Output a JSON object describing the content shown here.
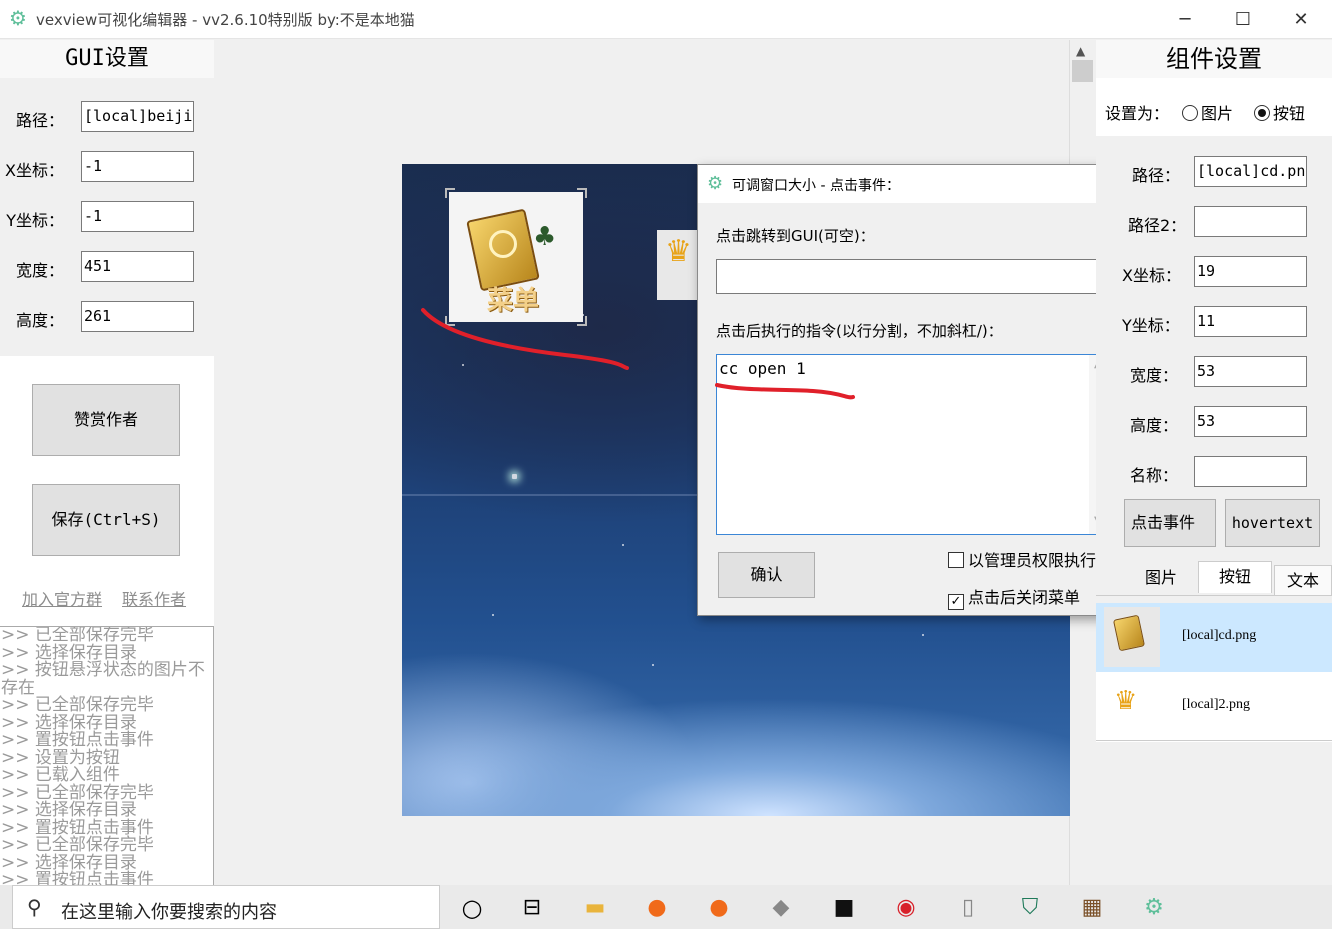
{
  "window": {
    "title": "vexview可视化编辑器 - vv2.6.10特别版  by:不是本地猫",
    "minimize": "─",
    "maximize": "☐",
    "close": "✕",
    "icon": "gear-icon"
  },
  "gui_settings": {
    "title": "GUI设置",
    "path_label": "路径：",
    "path_value": "[local]beijing.png",
    "x_label": "X坐标：",
    "x_value": "-1",
    "y_label": "Y坐标：",
    "y_value": "-1",
    "width_label": "宽度：",
    "width_value": "451",
    "height_label": "高度：",
    "height_value": "261",
    "donate_button": "赞赏作者",
    "save_button": "保存(Ctrl+S)",
    "join_group_link": "加入官方群",
    "contact_link": "联系作者"
  },
  "log": [
    ">> 已全部保存完毕",
    ">> 选择保存目录",
    ">> 按钮悬浮状态的图片不",
    "存在",
    ">> 已全部保存完毕",
    ">> 选择保存目录",
    ">> 置按钮点击事件",
    ">> 设置为按钮",
    ">> 已载入组件",
    ">> 已全部保存完毕",
    ">> 选择保存目录",
    ">> 置按钮点击事件",
    ">> 已全部保存完毕",
    ">> 选择保存目录",
    ">> 置按钮点击事件"
  ],
  "canvas": {
    "menu_icon_text": "菜单"
  },
  "dialog": {
    "title": "可调窗口大小 - 点击事件：",
    "close": "✕",
    "goto_label": "点击跳转到GUI(可空)：",
    "goto_value": "",
    "command_label": "点击后执行的指令(以行分割，不加斜杠/)：",
    "command_value": "cc open 1",
    "confirm_button": "确认",
    "admin_checkbox": "以管理员权限执行",
    "admin_checked": false,
    "close_menu_checkbox": "点击后关闭菜单",
    "close_menu_checked": true
  },
  "component_settings": {
    "title": "组件设置",
    "set_as_label": "设置为：",
    "option_image": "图片",
    "option_button": "按钮",
    "selected": "按钮",
    "path_label": "路径：",
    "path_value": "[local]cd.png",
    "path2_label": "路径2：",
    "path2_value": "",
    "x_label": "X坐标：",
    "x_value": "19",
    "y_label": "Y坐标：",
    "y_value": "11",
    "width_label": "宽度：",
    "width_value": "53",
    "height_label": "高度：",
    "height_value": "53",
    "name_label": "名称：",
    "name_value": "",
    "click_event_button": "点击事件",
    "hovertext_button": "hovertext",
    "tabs": [
      "图片",
      "按钮",
      "文本"
    ],
    "active_tab": "按钮",
    "list": [
      {
        "label": "[local]cd.png",
        "selected": true
      },
      {
        "label": "[local]2.png",
        "selected": false
      }
    ]
  },
  "taskbar": {
    "search_placeholder": "在这里输入你要搜索的内容",
    "apps": [
      "cortana-icon",
      "task-view-icon",
      "file-explorer-icon",
      "firefox-icon",
      "firefox-icon",
      "app-icon",
      "terminal-icon",
      "netease-music-icon",
      "file-icon",
      "security-icon",
      "minecraft-icon",
      "gear-icon"
    ]
  },
  "colors": {
    "annotation_red": "#e0202a",
    "selection_blue": "#cce8ff",
    "accent": "#5fbf9a"
  }
}
